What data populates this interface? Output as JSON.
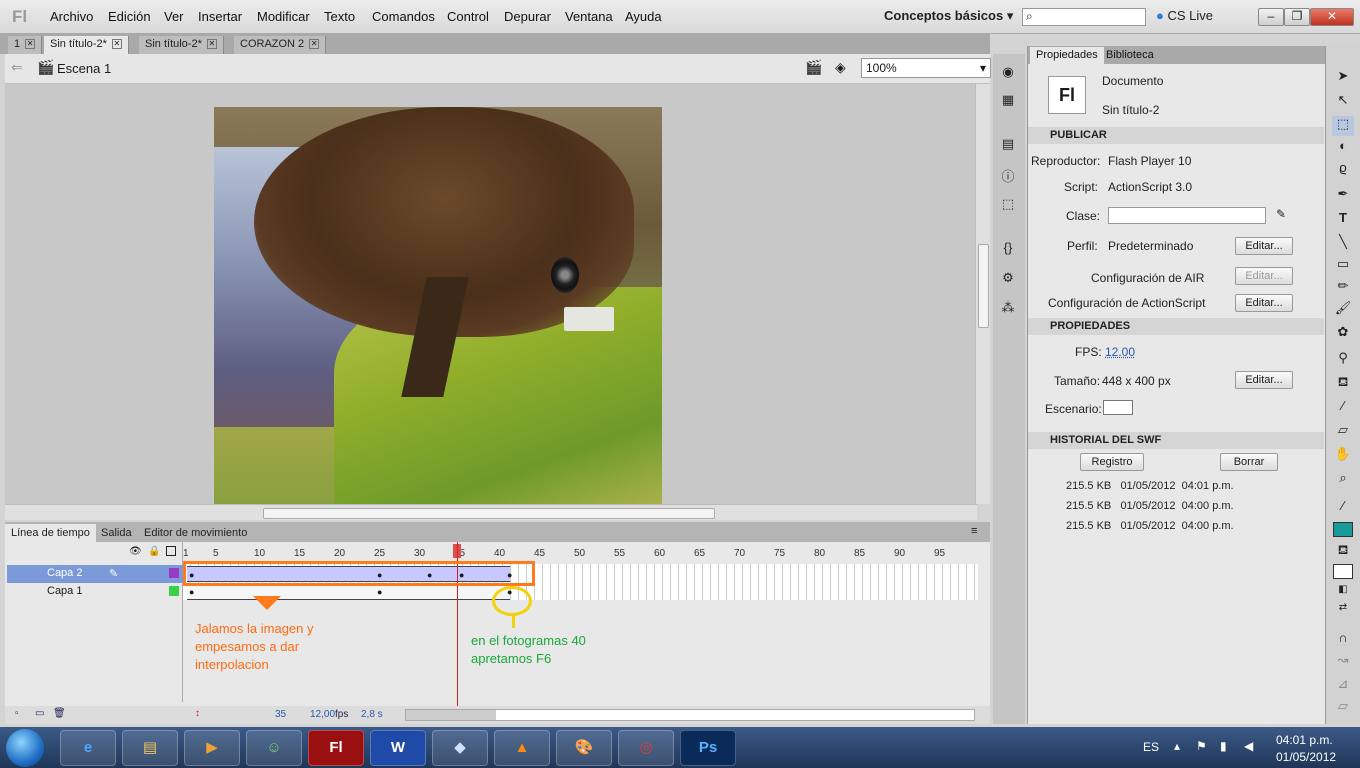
{
  "app": {
    "logo": "Fl"
  },
  "menu": [
    "Archivo",
    "Edición",
    "Ver",
    "Insertar",
    "Modificar",
    "Texto",
    "Comandos",
    "Control",
    "Depurar",
    "Ventana",
    "Ayuda"
  ],
  "workspace": "Conceptos básicos",
  "cslive": "CS Live",
  "window_buttons": {
    "minimize": "–",
    "restore": "❐",
    "close": "✕"
  },
  "doc_tabs": [
    {
      "label": "1",
      "active": false
    },
    {
      "label": "Sin título-2*",
      "active": true
    },
    {
      "label": "Sin título-2*",
      "active": false
    },
    {
      "label": "CORAZON 2",
      "active": false
    }
  ],
  "scene": "Escena 1",
  "zoom": "100%",
  "panel_tabs": [
    "Línea de tiempo",
    "Salida",
    "Editor de movimiento"
  ],
  "timeline": {
    "ruler": [
      "1",
      "5",
      "10",
      "15",
      "20",
      "25",
      "30",
      "35",
      "40",
      "45",
      "50",
      "55",
      "60",
      "65",
      "70",
      "75",
      "80",
      "85",
      "90",
      "95"
    ],
    "layers": [
      {
        "name": "Capa 2",
        "selected": true
      },
      {
        "name": "Capa 1",
        "selected": false
      }
    ],
    "current_frame": "35",
    "fps": "12,00",
    "fps_unit": "fps",
    "time": "2,8 s"
  },
  "annotations": {
    "orange_note": "Jalamos la imagen y empesamos a dar interpolacion",
    "green_note": "en el fotogramas 40 apretamos F6"
  },
  "properties": {
    "tabs": [
      "Propiedades",
      "Biblioteca"
    ],
    "doc_icon": "Fl",
    "doc_type": "Documento",
    "doc_name": "Sin título-2",
    "publish": {
      "title": "PUBLICAR",
      "player_label": "Reproductor:",
      "player": "Flash Player 10",
      "script_label": "Script:",
      "script": "ActionScript 3.0",
      "class_label": "Clase:",
      "profile_label": "Perfil:",
      "profile": "Predeterminado",
      "air": "Configuración de AIR",
      "as_settings": "Configuración de ActionScript",
      "edit": "Editar..."
    },
    "props": {
      "title": "PROPIEDADES",
      "fps_label": "FPS:",
      "fps": "12.00",
      "size_label": "Tamaño:",
      "size": "448 x 400 px",
      "stage_label": "Escenario:",
      "edit": "Editar..."
    },
    "history": {
      "title": "HISTORIAL DEL SWF",
      "log_btn": "Registro",
      "clear_btn": "Borrar",
      "rows": [
        {
          "size": "215.5 KB",
          "date": "01/05/2012",
          "time": "04:01 p.m."
        },
        {
          "size": "215.5 KB",
          "date": "01/05/2012",
          "time": "04:00 p.m."
        },
        {
          "size": "215.5 KB",
          "date": "01/05/2012",
          "time": "04:00 p.m."
        }
      ]
    }
  },
  "taskbar": {
    "lang": "ES",
    "time": "04:01 p.m.",
    "date": "01/05/2012",
    "apps": [
      "Fl",
      "W",
      "Ps"
    ]
  }
}
